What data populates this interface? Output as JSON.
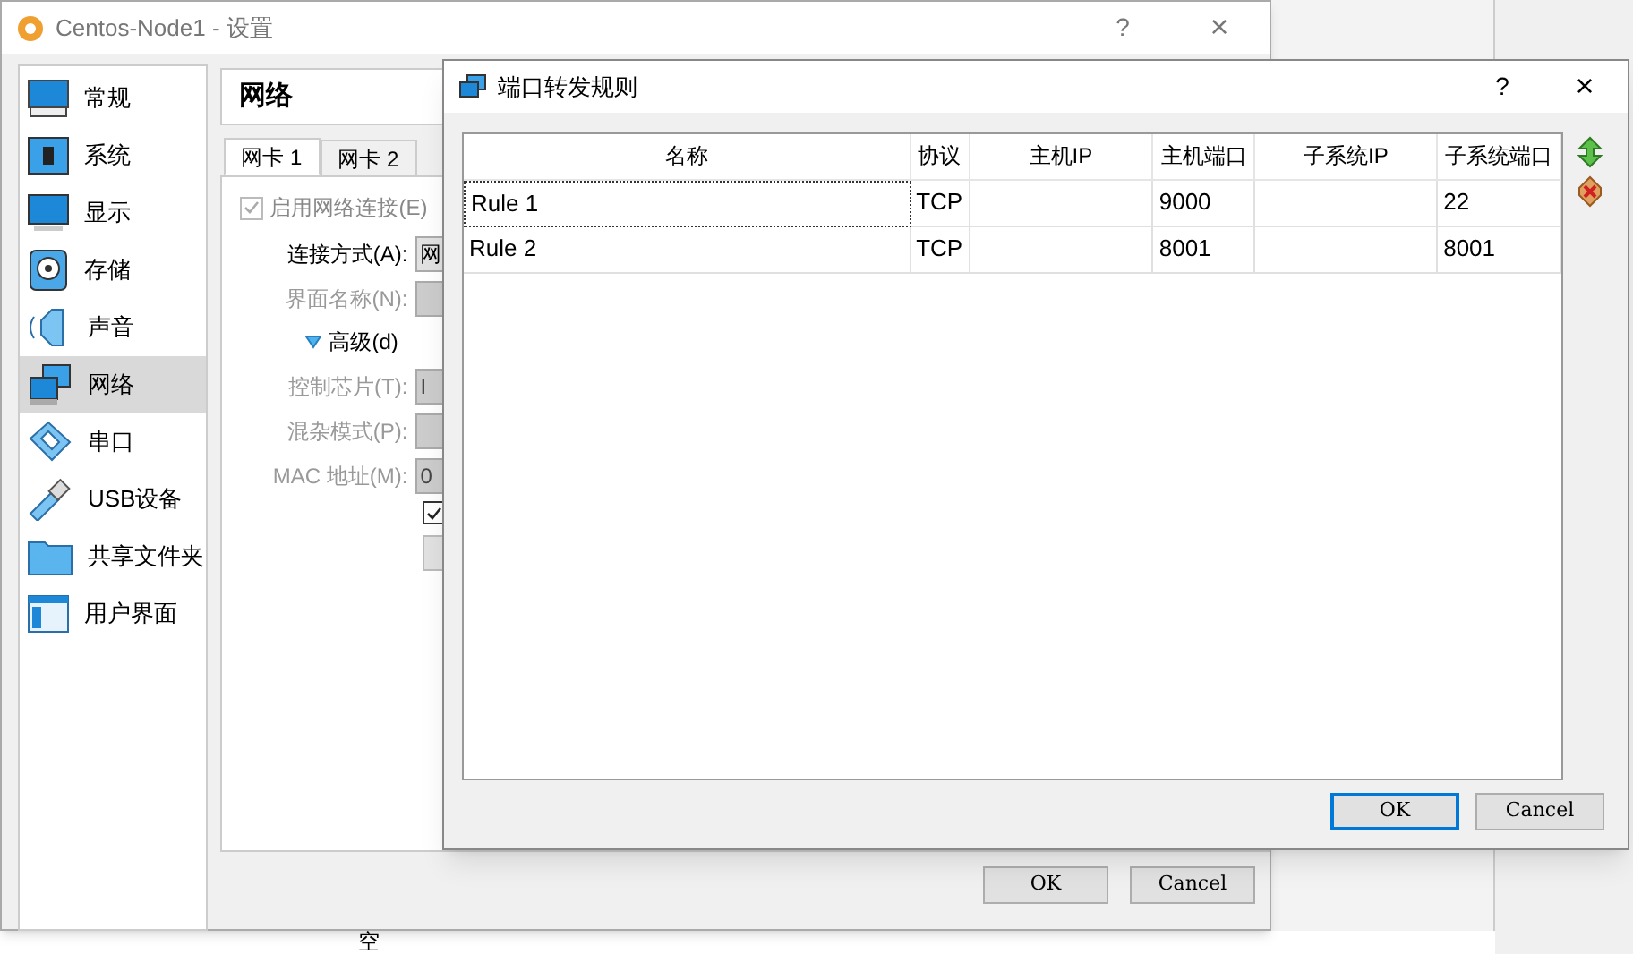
{
  "settings_window": {
    "title": "Centos-Node1 - 设置",
    "help": "?",
    "close": "×",
    "sidebar": {
      "items": [
        {
          "label": "常规",
          "selected": false
        },
        {
          "label": "系统",
          "selected": false
        },
        {
          "label": "显示",
          "selected": false
        },
        {
          "label": "存储",
          "selected": false
        },
        {
          "label": "声音",
          "selected": false
        },
        {
          "label": "网络",
          "selected": true
        },
        {
          "label": "串口",
          "selected": false
        },
        {
          "label": "USB设备",
          "selected": false
        },
        {
          "label": "共享文件夹",
          "selected": false
        },
        {
          "label": "用户界面",
          "selected": false
        }
      ]
    },
    "section_title": "网络",
    "tabs": [
      {
        "label": "网卡 1",
        "selected": true
      },
      {
        "label": "网卡 2",
        "selected": false
      }
    ],
    "enable_checkbox": {
      "label": "启用网络连接(E)",
      "checked": true
    },
    "form": [
      {
        "kind": "field",
        "label": "连接方式(A):",
        "value": "网",
        "disabled": false
      },
      {
        "kind": "field",
        "label": "界面名称(N):",
        "disabled": true
      },
      {
        "kind": "expander",
        "label": "高级(d)",
        "expanded": true
      },
      {
        "kind": "field",
        "label": "控制芯片(T):",
        "value": "I",
        "disabled": true
      },
      {
        "kind": "field",
        "label": "混杂模式(P):",
        "disabled": true
      },
      {
        "kind": "field",
        "label": "MAC 地址(M):",
        "value": "0",
        "disabled": true
      }
    ],
    "cable_checkbox": {
      "checked": true
    },
    "buttons": [
      "OK",
      "Cancel"
    ]
  },
  "dialog": {
    "title": "端口转发规则",
    "help": "?",
    "close": "×",
    "table": {
      "columns": [
        "名称",
        "协议",
        "主机IP",
        "主机端口",
        "子系统IP",
        "子系统端口"
      ],
      "rows": [
        {
          "cells": [
            "Rule 1",
            "TCP",
            "",
            "9000",
            "",
            "22"
          ],
          "focused": true
        },
        {
          "cells": [
            "Rule 2",
            "TCP",
            "",
            "8001",
            "",
            "8001"
          ],
          "focused": false
        }
      ]
    },
    "buttons": [
      {
        "label": "OK",
        "default": true
      },
      {
        "label": "Cancel",
        "default": false
      }
    ]
  },
  "desktop_text": "空"
}
